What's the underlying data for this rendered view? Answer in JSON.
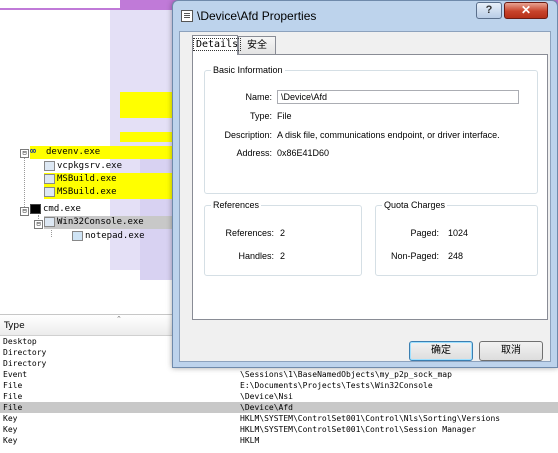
{
  "process_tree": {
    "items": [
      {
        "label": "devenv.exe",
        "highlight": "yellow"
      },
      {
        "label": "vcpkgsrv.exe",
        "highlight": "none"
      },
      {
        "label": "MSBuild.exe",
        "highlight": "yellow"
      },
      {
        "label": "MSBuild.exe",
        "highlight": "yellow"
      },
      {
        "label": "cmd.exe",
        "highlight": "none"
      },
      {
        "label": "Win32Console.exe",
        "highlight": "gray"
      },
      {
        "label": "notepad.exe",
        "highlight": "none"
      }
    ],
    "expander_symbol": "⊟"
  },
  "handles": {
    "column_type": "Type",
    "rows": [
      {
        "type": "Desktop",
        "name": ""
      },
      {
        "type": "Directory",
        "name": ""
      },
      {
        "type": "Directory",
        "name": ""
      },
      {
        "type": "Event",
        "name": "\\Sessions\\1\\BaseNamedObjects\\my_p2p_sock_map"
      },
      {
        "type": "File",
        "name": "E:\\Documents\\Projects\\Tests\\Win32Console"
      },
      {
        "type": "File",
        "name": "\\Device\\Nsi"
      },
      {
        "type": "File",
        "name": "\\Device\\Afd",
        "selected": true
      },
      {
        "type": "Key",
        "name": "HKLM\\SYSTEM\\ControlSet001\\Control\\Nls\\Sorting\\Versions"
      },
      {
        "type": "Key",
        "name": "HKLM\\SYSTEM\\ControlSet001\\Control\\Session Manager"
      },
      {
        "type": "Key",
        "name": "HKLM"
      }
    ]
  },
  "dialog": {
    "title": "\\Device\\Afd Properties",
    "help_label": "?",
    "close_label": "✕",
    "tabs": [
      {
        "label": "Details",
        "active": true
      },
      {
        "label": "安全",
        "active": false
      }
    ],
    "basic": {
      "title": "Basic Information",
      "name_label": "Name:",
      "name_value": "\\Device\\Afd",
      "type_label": "Type:",
      "type_value": "File",
      "desc_label": "Description:",
      "desc_value": "A disk file, communications endpoint, or driver interface.",
      "addr_label": "Address:",
      "addr_value": "0x86E41D60"
    },
    "references": {
      "title": "References",
      "refs_label": "References:",
      "refs_value": "2",
      "handles_label": "Handles:",
      "handles_value": "2"
    },
    "quota": {
      "title": "Quota Charges",
      "paged_label": "Paged:",
      "paged_value": "1024",
      "nonpaged_label": "Non-Paged:",
      "nonpaged_value": "248"
    },
    "ok_label": "确定",
    "cancel_label": "取消"
  }
}
